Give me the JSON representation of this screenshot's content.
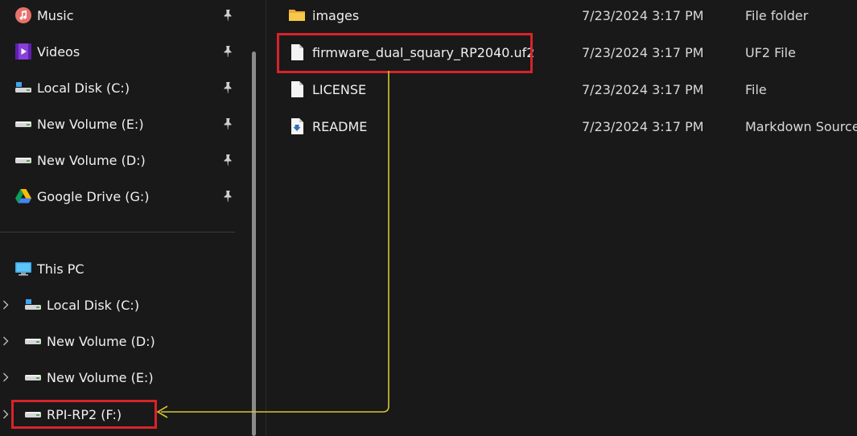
{
  "quick_access": [
    {
      "label": "Music",
      "icon": "music-icon"
    },
    {
      "label": "Videos",
      "icon": "videos-icon"
    },
    {
      "label": "Local Disk (C:)",
      "icon": "local-disk-icon"
    },
    {
      "label": "New Volume (E:)",
      "icon": "drive-icon"
    },
    {
      "label": "New Volume (D:)",
      "icon": "drive-icon"
    },
    {
      "label": "Google Drive (G:)",
      "icon": "google-drive-icon"
    }
  ],
  "this_pc": {
    "label": "This PC",
    "children": [
      {
        "label": "Local Disk (C:)"
      },
      {
        "label": "New Volume (D:)"
      },
      {
        "label": "New Volume (E:)"
      },
      {
        "label": "RPI-RP2 (F:)"
      }
    ]
  },
  "files": [
    {
      "name": "images",
      "date": "7/23/2024 3:17 PM",
      "type": "File folder",
      "icon": "folder-icon"
    },
    {
      "name": "firmware_dual_squary_RP2040.uf2",
      "date": "7/23/2024 3:17 PM",
      "type": "UF2 File",
      "icon": "file-icon"
    },
    {
      "name": "LICENSE",
      "date": "7/23/2024 3:17 PM",
      "type": "File",
      "icon": "file-icon"
    },
    {
      "name": "README",
      "date": "7/23/2024 3:17 PM",
      "type": "Markdown Source",
      "icon": "markdown-file-icon"
    }
  ],
  "colors": {
    "background": "#191919",
    "highlight": "#d8232a",
    "arrow": "#d4c632",
    "folder": "#f2c14e"
  }
}
